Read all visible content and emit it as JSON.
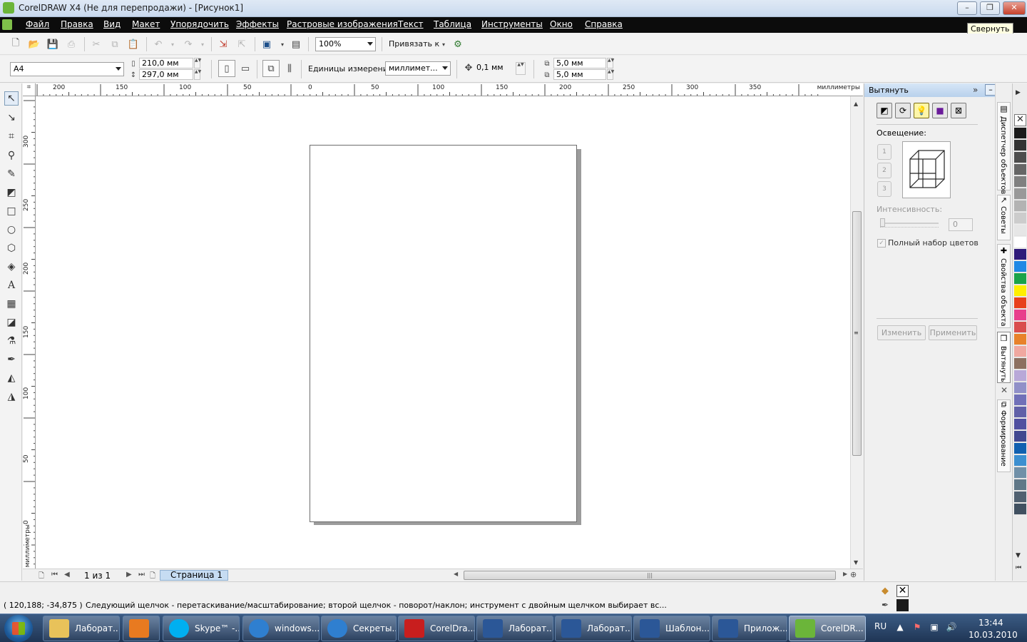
{
  "window": {
    "title": "CorelDRAW X4 (Не для перепродажи) - [Рисунок1]",
    "minimize_label": "–",
    "maximize_label": "❐",
    "close_label": "✕",
    "tooltip": "Свернуть"
  },
  "menu": [
    "Файл",
    "Правка",
    "Вид",
    "Макет",
    "Упорядочить",
    "Эффекты",
    "Растровые изображения",
    "Текст",
    "Таблица",
    "Инструменты",
    "Окно",
    "Справка"
  ],
  "standard_toolbar": {
    "zoom": "100%",
    "snap_to": "Привязать к"
  },
  "property_bar": {
    "paper_size": "A4",
    "width": "210,0 мм",
    "height": "297,0 мм",
    "units_label": "Единицы измерения:",
    "units_value": "миллимет...",
    "nudge": "0,1 мм",
    "dup_x": "5,0 мм",
    "dup_y": "5,0 мм"
  },
  "rulers": {
    "h_labels": [
      "200",
      "150",
      "100",
      "50",
      "0",
      "50",
      "100",
      "150",
      "200",
      "250",
      "300",
      "350"
    ],
    "v_labels": [
      "300",
      "250",
      "200",
      "150",
      "100",
      "50",
      "0"
    ],
    "units": "миллиметры"
  },
  "page_nav": {
    "info": "1 из 1",
    "tab": "Страница 1"
  },
  "docker": {
    "title": "Вытянуть",
    "lighting_label": "Освещение:",
    "lights": [
      "1",
      "2",
      "3"
    ],
    "intensity_label": "Интенсивность:",
    "intensity_value": "0",
    "full_color_label": "Полный набор цветов",
    "edit_button": "Изменить",
    "apply_button": "Применить"
  },
  "docker_tabs": [
    "Диспетчер объектов",
    "Советы",
    "Свойства объекта",
    "Вытянуть",
    "Формирование"
  ],
  "palette": [
    "#1a1a1a",
    "#333333",
    "#4d4d4d",
    "#666666",
    "#808080",
    "#999999",
    "#b3b3b3",
    "#cccccc",
    "#e6e6e6",
    "#ffffff",
    "#2e1a7a",
    "#1e88e5",
    "#1aa34a",
    "#ffee00",
    "#e8401c",
    "#e83e8c",
    "#d94d4d",
    "#e8822a",
    "#f0a8a0",
    "#8c7060",
    "#b8a8d8",
    "#9090c8",
    "#7070b8",
    "#6060a8",
    "#5050a0",
    "#404890",
    "#1060b0",
    "#3c8fd0",
    "#7090a8",
    "#607888",
    "#506070",
    "#405060"
  ],
  "status": {
    "coords": "( 120,188; -34,875 )",
    "hint": "Следующий щелчок - перетаскивание/масштабирование; второй щелчок - поворот/наклон; инструмент с двойным щелчком выбирает вс..."
  },
  "taskbar": {
    "items": [
      {
        "label": "Лаборат...",
        "color": "#e8c25a"
      },
      {
        "label": "",
        "color": "#e87a20"
      },
      {
        "label": "Skype™ -...",
        "color": "#00aff0"
      },
      {
        "label": "windows...",
        "color": "#2f7fd0"
      },
      {
        "label": "Секреты...",
        "color": "#2f7fd0"
      },
      {
        "label": "CorelDra...",
        "color": "#c81e1e"
      },
      {
        "label": "Лаборат...",
        "color": "#2b5797"
      },
      {
        "label": "Лаборат...",
        "color": "#2b5797"
      },
      {
        "label": "Шаблон...",
        "color": "#2b5797"
      },
      {
        "label": "Прилож...",
        "color": "#2b5797"
      },
      {
        "label": "CorelDR...",
        "color": "#6bb53a"
      }
    ],
    "lang": "RU",
    "time": "13:44",
    "date": "10.03.2010"
  }
}
